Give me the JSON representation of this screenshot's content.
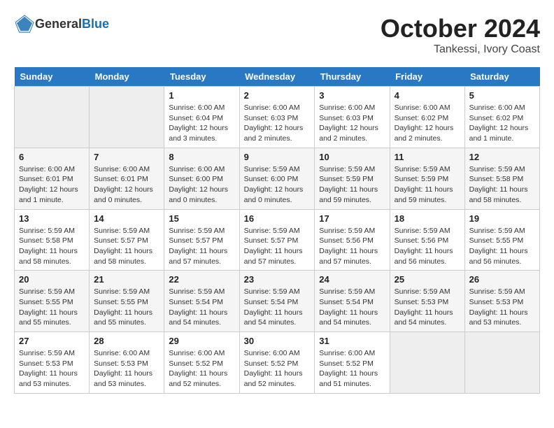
{
  "header": {
    "logo_general": "General",
    "logo_blue": "Blue",
    "month": "October 2024",
    "location": "Tankessi, Ivory Coast"
  },
  "weekdays": [
    "Sunday",
    "Monday",
    "Tuesday",
    "Wednesday",
    "Thursday",
    "Friday",
    "Saturday"
  ],
  "weeks": [
    [
      {
        "day": "",
        "info": ""
      },
      {
        "day": "",
        "info": ""
      },
      {
        "day": "1",
        "info": "Sunrise: 6:00 AM\nSunset: 6:04 PM\nDaylight: 12 hours and 3 minutes."
      },
      {
        "day": "2",
        "info": "Sunrise: 6:00 AM\nSunset: 6:03 PM\nDaylight: 12 hours and 2 minutes."
      },
      {
        "day": "3",
        "info": "Sunrise: 6:00 AM\nSunset: 6:03 PM\nDaylight: 12 hours and 2 minutes."
      },
      {
        "day": "4",
        "info": "Sunrise: 6:00 AM\nSunset: 6:02 PM\nDaylight: 12 hours and 2 minutes."
      },
      {
        "day": "5",
        "info": "Sunrise: 6:00 AM\nSunset: 6:02 PM\nDaylight: 12 hours and 1 minute."
      }
    ],
    [
      {
        "day": "6",
        "info": "Sunrise: 6:00 AM\nSunset: 6:01 PM\nDaylight: 12 hours and 1 minute."
      },
      {
        "day": "7",
        "info": "Sunrise: 6:00 AM\nSunset: 6:01 PM\nDaylight: 12 hours and 0 minutes."
      },
      {
        "day": "8",
        "info": "Sunrise: 6:00 AM\nSunset: 6:00 PM\nDaylight: 12 hours and 0 minutes."
      },
      {
        "day": "9",
        "info": "Sunrise: 5:59 AM\nSunset: 6:00 PM\nDaylight: 12 hours and 0 minutes."
      },
      {
        "day": "10",
        "info": "Sunrise: 5:59 AM\nSunset: 5:59 PM\nDaylight: 11 hours and 59 minutes."
      },
      {
        "day": "11",
        "info": "Sunrise: 5:59 AM\nSunset: 5:59 PM\nDaylight: 11 hours and 59 minutes."
      },
      {
        "day": "12",
        "info": "Sunrise: 5:59 AM\nSunset: 5:58 PM\nDaylight: 11 hours and 58 minutes."
      }
    ],
    [
      {
        "day": "13",
        "info": "Sunrise: 5:59 AM\nSunset: 5:58 PM\nDaylight: 11 hours and 58 minutes."
      },
      {
        "day": "14",
        "info": "Sunrise: 5:59 AM\nSunset: 5:57 PM\nDaylight: 11 hours and 58 minutes."
      },
      {
        "day": "15",
        "info": "Sunrise: 5:59 AM\nSunset: 5:57 PM\nDaylight: 11 hours and 57 minutes."
      },
      {
        "day": "16",
        "info": "Sunrise: 5:59 AM\nSunset: 5:57 PM\nDaylight: 11 hours and 57 minutes."
      },
      {
        "day": "17",
        "info": "Sunrise: 5:59 AM\nSunset: 5:56 PM\nDaylight: 11 hours and 57 minutes."
      },
      {
        "day": "18",
        "info": "Sunrise: 5:59 AM\nSunset: 5:56 PM\nDaylight: 11 hours and 56 minutes."
      },
      {
        "day": "19",
        "info": "Sunrise: 5:59 AM\nSunset: 5:55 PM\nDaylight: 11 hours and 56 minutes."
      }
    ],
    [
      {
        "day": "20",
        "info": "Sunrise: 5:59 AM\nSunset: 5:55 PM\nDaylight: 11 hours and 55 minutes."
      },
      {
        "day": "21",
        "info": "Sunrise: 5:59 AM\nSunset: 5:55 PM\nDaylight: 11 hours and 55 minutes."
      },
      {
        "day": "22",
        "info": "Sunrise: 5:59 AM\nSunset: 5:54 PM\nDaylight: 11 hours and 54 minutes."
      },
      {
        "day": "23",
        "info": "Sunrise: 5:59 AM\nSunset: 5:54 PM\nDaylight: 11 hours and 54 minutes."
      },
      {
        "day": "24",
        "info": "Sunrise: 5:59 AM\nSunset: 5:54 PM\nDaylight: 11 hours and 54 minutes."
      },
      {
        "day": "25",
        "info": "Sunrise: 5:59 AM\nSunset: 5:53 PM\nDaylight: 11 hours and 54 minutes."
      },
      {
        "day": "26",
        "info": "Sunrise: 5:59 AM\nSunset: 5:53 PM\nDaylight: 11 hours and 53 minutes."
      }
    ],
    [
      {
        "day": "27",
        "info": "Sunrise: 5:59 AM\nSunset: 5:53 PM\nDaylight: 11 hours and 53 minutes."
      },
      {
        "day": "28",
        "info": "Sunrise: 6:00 AM\nSunset: 5:53 PM\nDaylight: 11 hours and 53 minutes."
      },
      {
        "day": "29",
        "info": "Sunrise: 6:00 AM\nSunset: 5:52 PM\nDaylight: 11 hours and 52 minutes."
      },
      {
        "day": "30",
        "info": "Sunrise: 6:00 AM\nSunset: 5:52 PM\nDaylight: 11 hours and 52 minutes."
      },
      {
        "day": "31",
        "info": "Sunrise: 6:00 AM\nSunset: 5:52 PM\nDaylight: 11 hours and 51 minutes."
      },
      {
        "day": "",
        "info": ""
      },
      {
        "day": "",
        "info": ""
      }
    ]
  ]
}
